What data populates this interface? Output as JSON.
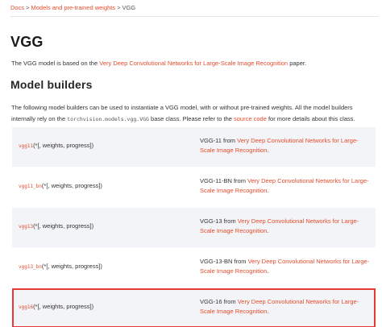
{
  "breadcrumb": {
    "items": [
      "Docs",
      "Models and pre-trained weights",
      "VGG"
    ],
    "separator": ">"
  },
  "title": "VGG",
  "intro": {
    "before": "The VGG model is based on the ",
    "link": "Very Deep Convolutional Networks for Large-Scale Image Recognition",
    "after": " paper."
  },
  "section_title": "Model builders",
  "description": {
    "part1": "The following model builders can be used to instantiate a VGG model, with or without pre-trained weights. All the model builders internally rely on the ",
    "code": "torchvision.models.vgg.VGG",
    "part2": " base class. Please refer to the ",
    "link": "source code",
    "part3": " for more details about this class."
  },
  "builders": [
    {
      "name": "vgg11",
      "signature": "(*[, weights, progress])",
      "label": "VGG-11 from ",
      "link": "Very Deep Convolutional Networks for Large-Scale Image Recognition",
      "suffix": "."
    },
    {
      "name": "vgg11_bn",
      "signature": "(*[, weights, progress])",
      "label": "VGG-11-BN from ",
      "link": "Very Deep Convolutional Networks for Large-Scale Image Recognition",
      "suffix": "."
    },
    {
      "name": "vgg13",
      "signature": "(*[, weights, progress])",
      "label": "VGG-13 from ",
      "link": "Very Deep Convolutional Networks for Large-Scale Image Recognition",
      "suffix": "."
    },
    {
      "name": "vgg13_bn",
      "signature": "(*[, weights, progress])",
      "label": "VGG-13-BN from ",
      "link": "Very Deep Convolutional Networks for Large-Scale Image Recognition",
      "suffix": "."
    },
    {
      "name": "vgg16",
      "signature": "(*[, weights, progress])",
      "label": "VGG-16 from ",
      "link": "Very Deep Convolutional Networks for Large-Scale Image Recognition",
      "suffix": "."
    }
  ],
  "colors": {
    "link": "#e44c2c",
    "highlight_border": "#e53935",
    "row_background": "#f3f4f7"
  }
}
